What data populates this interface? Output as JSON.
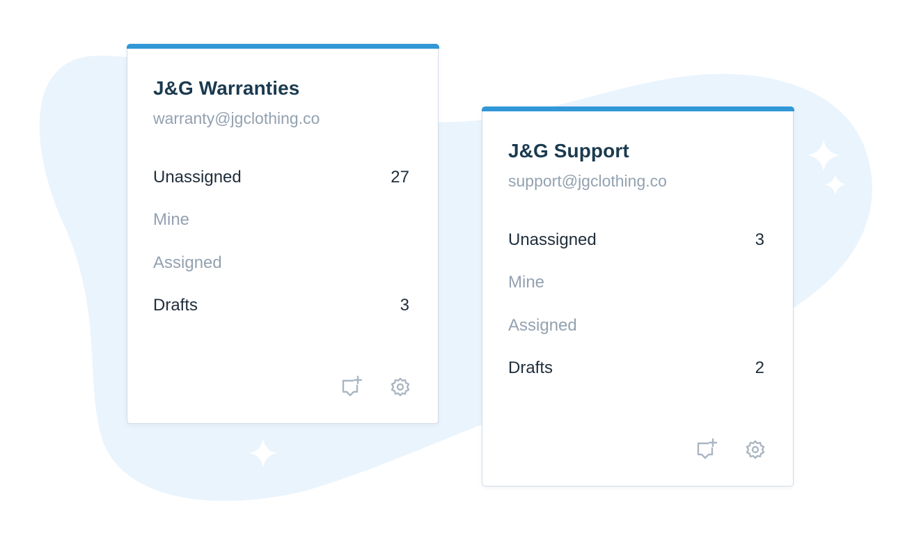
{
  "colors": {
    "accent_bar": "#3197d6",
    "blob": "#eaf4fd",
    "title_text": "#1b3a4f",
    "muted_text": "#93a1b0",
    "primary_text": "#1f2d3a",
    "icon": "#aab6c2"
  },
  "decorations": [
    "sparkle-icon",
    "sparkle-icon",
    "sparkle-icon"
  ],
  "inboxes": [
    {
      "title": "J&G Warranties",
      "email": "warranty@jgclothing.co",
      "folders": [
        {
          "label": "Unassigned",
          "count": "27"
        },
        {
          "label": "Mine",
          "count": ""
        },
        {
          "label": "Assigned",
          "count": ""
        },
        {
          "label": "Drafts",
          "count": "3"
        }
      ],
      "actions": [
        "new-conversation-icon",
        "gear-icon"
      ]
    },
    {
      "title": "J&G Support",
      "email": "support@jgclothing.co",
      "folders": [
        {
          "label": "Unassigned",
          "count": "3"
        },
        {
          "label": "Mine",
          "count": ""
        },
        {
          "label": "Assigned",
          "count": ""
        },
        {
          "label": "Drafts",
          "count": "2"
        }
      ],
      "actions": [
        "new-conversation-icon",
        "gear-icon"
      ]
    }
  ]
}
